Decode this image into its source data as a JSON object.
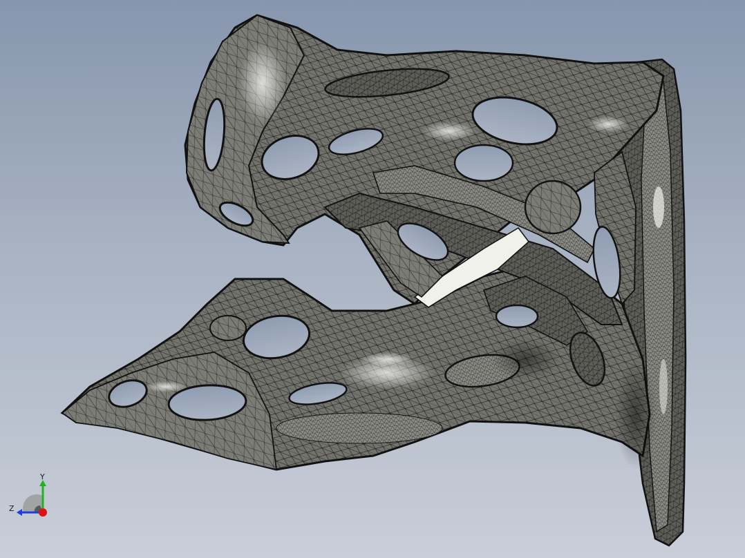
{
  "viewport": {
    "background_top": "#8796ad",
    "background_bottom": "#c9ced8"
  },
  "model": {
    "name": "topology-optimized-bracket-mesh",
    "surface_color": "#6e6e68",
    "edge_color": "#111111",
    "highlight_color": "#e6e6e0"
  },
  "triad": {
    "x_axis_color": "#d81414",
    "y_axis_color": "#1fb31f",
    "z_axis_color": "#1d3fe0",
    "y_label": "Y",
    "z_label": "Z"
  }
}
